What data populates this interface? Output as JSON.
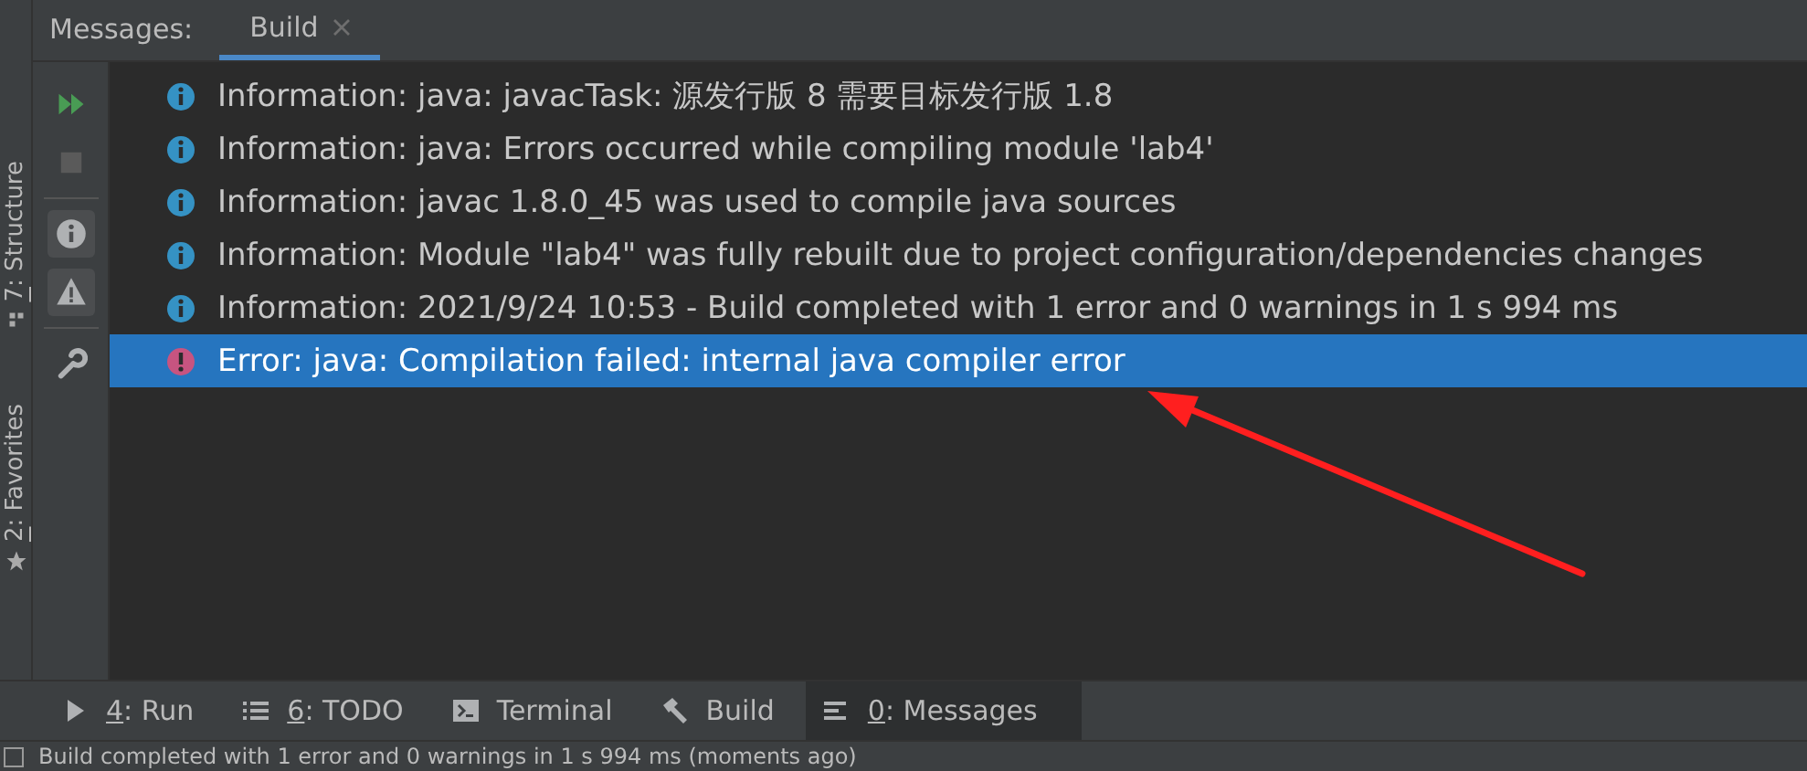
{
  "tool_window": {
    "title": "Messages:",
    "tabs": [
      {
        "label": "Build",
        "selected": true
      }
    ]
  },
  "side_tabs": [
    {
      "mnemonic": "7",
      "label": ": Structure",
      "kind": "structure"
    },
    {
      "mnemonic": "2",
      "label": ": Favorites",
      "kind": "favorites"
    }
  ],
  "toolbar": [
    {
      "kind": "rerun"
    },
    {
      "kind": "stop",
      "disabled": true
    },
    {
      "kind": "separator"
    },
    {
      "kind": "info",
      "on": true
    },
    {
      "kind": "warning",
      "on": true
    },
    {
      "kind": "separator"
    },
    {
      "kind": "settings"
    }
  ],
  "messages": [
    {
      "kind": "info",
      "text": "Information: java: javacTask: 源发行版 8 需要目标发行版 1.8",
      "selected": false
    },
    {
      "kind": "info",
      "text": "Information: java: Errors occurred while compiling module 'lab4'",
      "selected": false
    },
    {
      "kind": "info",
      "text": "Information: javac 1.8.0_45 was used to compile java sources",
      "selected": false
    },
    {
      "kind": "info",
      "text": "Information: Module \"lab4\" was fully rebuilt due to project configuration/dependencies changes",
      "selected": false
    },
    {
      "kind": "info",
      "text": "Information: 2021/9/24 10:53 - Build completed with 1 error and 0 warnings in 1 s 994 ms",
      "selected": false
    },
    {
      "kind": "error",
      "text": "Error: java: Compilation failed: internal java compiler error",
      "selected": true
    }
  ],
  "bottom_tabs": [
    {
      "kind": "run",
      "mnemonic": "4",
      "label": ": Run",
      "selected": false
    },
    {
      "kind": "todo",
      "mnemonic": "6",
      "label": ": TODO",
      "selected": false
    },
    {
      "kind": "terminal",
      "label": "Terminal",
      "selected": false
    },
    {
      "kind": "build",
      "label": "Build",
      "selected": false
    },
    {
      "kind": "messages",
      "mnemonic": "0",
      "label": ": Messages",
      "selected": true
    }
  ],
  "status_bar": {
    "text": "Build completed with 1 error and 0 warnings in 1 s 994 ms (moments ago)"
  }
}
